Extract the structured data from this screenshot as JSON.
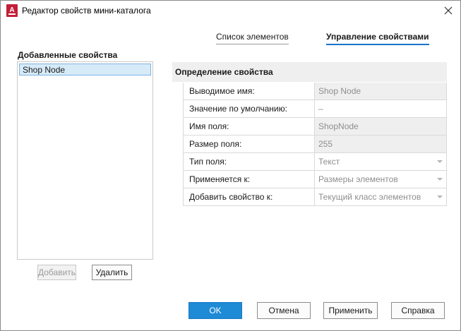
{
  "window": {
    "title": "Редактор свойств мини-каталога",
    "app_icon_letter": "A"
  },
  "tabs": [
    {
      "label": "Список элементов",
      "active": false
    },
    {
      "label": "Управление свойствами",
      "active": true
    }
  ],
  "left_panel": {
    "label": "Добавленные свойства",
    "items": [
      {
        "label": "Shop Node",
        "selected": true
      }
    ],
    "add_label": "Добавить",
    "delete_label": "Удалить"
  },
  "definition": {
    "header": "Определение свойства",
    "rows": [
      {
        "label": "Выводимое имя:",
        "value": "Shop Node",
        "dropdown": false
      },
      {
        "label": "Значение по умолчанию:",
        "value": "–",
        "dropdown": false
      },
      {
        "label": "Имя поля:",
        "value": "ShopNode",
        "dropdown": false
      },
      {
        "label": "Размер поля:",
        "value": "255",
        "dropdown": false
      },
      {
        "label": "Тип поля:",
        "value": "Текст",
        "dropdown": true
      },
      {
        "label": "Применяется к:",
        "value": "Размеры элементов",
        "dropdown": true
      },
      {
        "label": "Добавить свойство к:",
        "value": "Текущий класс элементов",
        "dropdown": true
      }
    ]
  },
  "footer": {
    "ok_label": "OK",
    "cancel_label": "Отмена",
    "apply_label": "Применить",
    "help_label": "Справка"
  },
  "colors": {
    "accent": "#1f8ad6",
    "tab_underline": "#1a73c8",
    "selection": "#d6eaf8"
  }
}
